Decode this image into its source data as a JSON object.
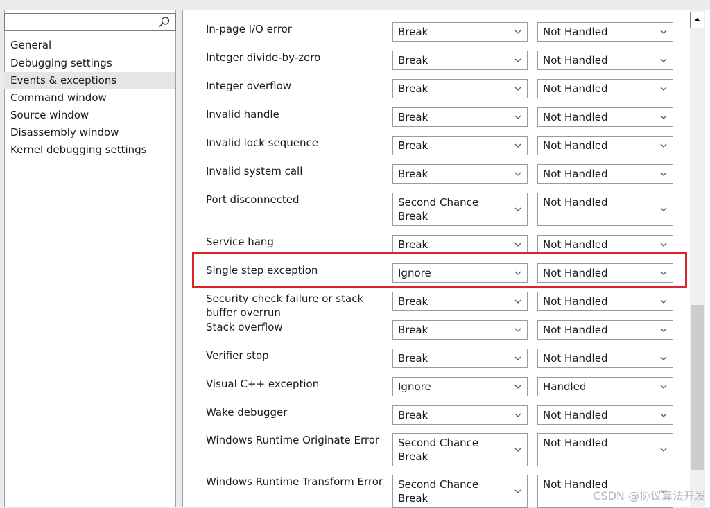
{
  "nav": {
    "search_placeholder": "",
    "items": [
      {
        "label": "General"
      },
      {
        "label": "Debugging settings"
      },
      {
        "label": "Events & exceptions"
      },
      {
        "label": "Command window"
      },
      {
        "label": "Source window"
      },
      {
        "label": "Disassembly window"
      },
      {
        "label": "Kernel debugging settings"
      }
    ],
    "selected": "Events & exceptions"
  },
  "exceptions": [
    {
      "label": "In-page I/O error",
      "action": "Break",
      "handling": "Not Handled"
    },
    {
      "label": "Integer divide-by-zero",
      "action": "Break",
      "handling": "Not Handled"
    },
    {
      "label": "Integer overflow",
      "action": "Break",
      "handling": "Not Handled"
    },
    {
      "label": "Invalid handle",
      "action": "Break",
      "handling": "Not Handled"
    },
    {
      "label": "Invalid lock sequence",
      "action": "Break",
      "handling": "Not Handled"
    },
    {
      "label": "Invalid system call",
      "action": "Break",
      "handling": "Not Handled"
    },
    {
      "label": "Port disconnected",
      "action": "Second Chance Break",
      "handling": "Not Handled"
    },
    {
      "label": "Service hang",
      "action": "Break",
      "handling": "Not Handled"
    },
    {
      "label": "Single step exception",
      "action": "Ignore",
      "handling": "Not Handled"
    },
    {
      "label": "Security check failure or stack buffer overrun",
      "action": "Break",
      "handling": "Not Handled"
    },
    {
      "label": "Stack overflow",
      "action": "Break",
      "handling": "Not Handled"
    },
    {
      "label": "Verifier stop",
      "action": "Break",
      "handling": "Not Handled"
    },
    {
      "label": "Visual C++ exception",
      "action": "Ignore",
      "handling": "Handled"
    },
    {
      "label": "Wake debugger",
      "action": "Break",
      "handling": "Not Handled"
    },
    {
      "label": "Windows Runtime Originate Error",
      "action": "Second Chance Break",
      "handling": "Not Handled"
    },
    {
      "label": "Windows Runtime Transform Error",
      "action": "Second Chance Break",
      "handling": "Not Handled"
    }
  ],
  "highlight_color": "#d9262b",
  "watermark": "CSDN @协议算法开发"
}
